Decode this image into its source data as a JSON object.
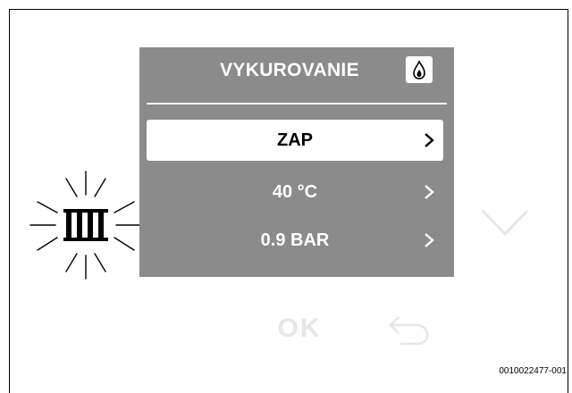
{
  "panel": {
    "title": "VYKUROVANIE",
    "mode_icon": "flame-icon",
    "rows": [
      {
        "label": "ZAP",
        "selected": true
      },
      {
        "label": "40 °C",
        "selected": false
      },
      {
        "label": "0.9 BAR",
        "selected": false
      }
    ]
  },
  "controls": {
    "ok_label": "OK",
    "down_icon": "chevron-down-icon",
    "back_icon": "back-arrow-icon",
    "heating_icon": "radiator-icon"
  },
  "figure_ref": "0010022477-001",
  "colors": {
    "screen_bg": "#8b8b8b",
    "text_on_screen": "#ffffff",
    "selected_row_bg": "#ffffff",
    "inactive_button": "#e6e6e6"
  }
}
